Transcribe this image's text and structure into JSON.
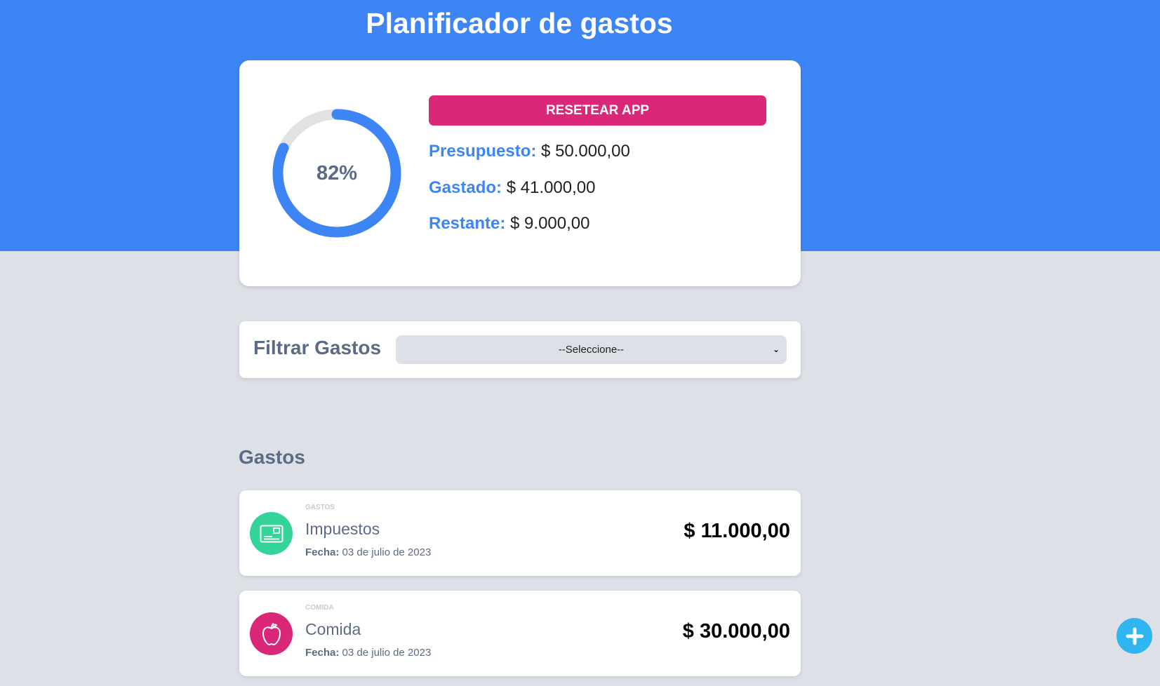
{
  "header": {
    "title": "Planificador de gastos"
  },
  "budget": {
    "percent": 82,
    "percent_label": "82%",
    "reset_label": "Resetear app",
    "budget_label": "Presupuesto:",
    "budget_value": "$ 50.000,00",
    "spent_label": "Gastado:",
    "spent_value": "$ 41.000,00",
    "remaining_label": "Restante:",
    "remaining_value": "$ 9.000,00"
  },
  "filter": {
    "label": "Filtrar Gastos",
    "selected": "--Seleccione--"
  },
  "expenses": {
    "title": "Gastos",
    "items": [
      {
        "category": "Gastos",
        "icon": "card-icon",
        "name": "Impuestos",
        "date_label": "Fecha:",
        "date": "03 de julio de 2023",
        "amount": "$ 11.000,00"
      },
      {
        "category": "Comida",
        "icon": "apple-icon",
        "name": "Comida",
        "date_label": "Fecha:",
        "date": "03 de julio de 2023",
        "amount": "$ 30.000,00"
      }
    ]
  },
  "colors": {
    "primary": "#3d85f4",
    "accent": "#db2777",
    "gastos_icon_bg": "#34d399",
    "comida_icon_bg": "#db2777",
    "fab": "#2fb5f0",
    "background": "#dde0e7"
  }
}
